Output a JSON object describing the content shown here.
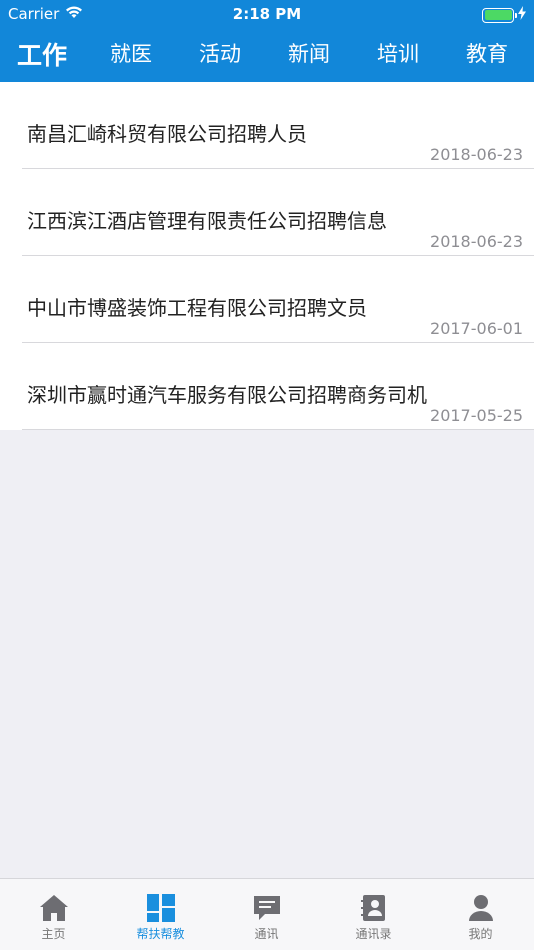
{
  "status_bar": {
    "carrier": "Carrier",
    "time": "2:18 PM"
  },
  "top_tabs": [
    {
      "label": "工作",
      "active": true
    },
    {
      "label": "就医",
      "active": false
    },
    {
      "label": "活动",
      "active": false
    },
    {
      "label": "新闻",
      "active": false
    },
    {
      "label": "培训",
      "active": false
    },
    {
      "label": "教育",
      "active": false
    }
  ],
  "list": [
    {
      "title": "南昌汇崎科贸有限公司招聘人员",
      "date": "2018-06-23"
    },
    {
      "title": "江西滨江酒店管理有限责任公司招聘信息",
      "date": "2018-06-23"
    },
    {
      "title": "中山市博盛装饰工程有限公司招聘文员",
      "date": "2017-06-01"
    },
    {
      "title": "深圳市赢时通汽车服务有限公司招聘商务司机",
      "date": "2017-05-25"
    }
  ],
  "bottom_tabs": [
    {
      "label": "主页",
      "icon": "home-icon",
      "active": false
    },
    {
      "label": "帮扶帮教",
      "icon": "grid-icon",
      "active": true
    },
    {
      "label": "通讯",
      "icon": "message-icon",
      "active": false
    },
    {
      "label": "通讯录",
      "icon": "contacts-icon",
      "active": false
    },
    {
      "label": "我的",
      "icon": "profile-icon",
      "active": false
    }
  ],
  "colors": {
    "header_bg": "#1287d9",
    "active_tab": "#1a8fde",
    "inactive_tab": "#777777",
    "battery": "#4cd964"
  }
}
